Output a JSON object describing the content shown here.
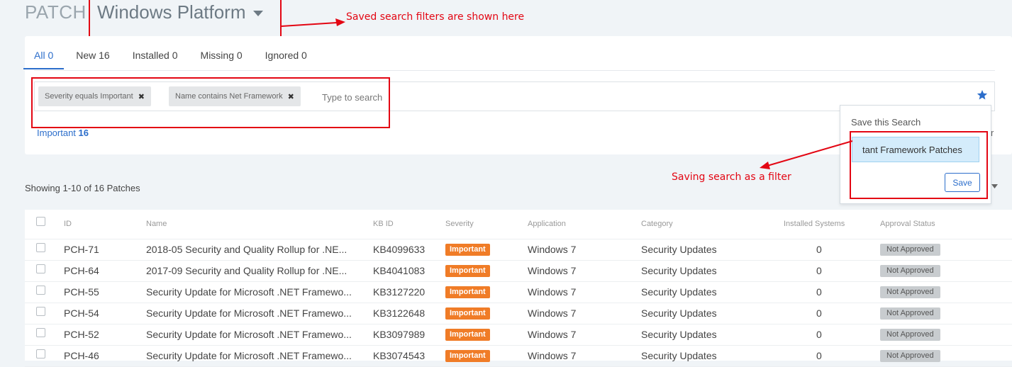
{
  "header": {
    "title": "PATCH",
    "platform": "Windows Platform"
  },
  "annotations": {
    "saved_filters_note": "Saved search filters are shown here",
    "saving_note": "Saving search as a filter"
  },
  "tabs": [
    {
      "label": "All 0"
    },
    {
      "label": "New 16"
    },
    {
      "label": "Installed 0"
    },
    {
      "label": "Missing 0"
    },
    {
      "label": "Ignored 0"
    }
  ],
  "filters": [
    {
      "label": "Severity equals Important"
    },
    {
      "label": "Name contains Net Framework"
    }
  ],
  "search": {
    "placeholder": "Type to search"
  },
  "facet": {
    "label": "Important",
    "count": "16"
  },
  "save_popover": {
    "title": "Save this Search",
    "name_value": "tant Framework Patches",
    "save_label": "Save",
    "edge_text": "r"
  },
  "results": {
    "summary": "Showing 1-10 of 16 Patches"
  },
  "table": {
    "columns": [
      "ID",
      "Name",
      "KB ID",
      "Severity",
      "Application",
      "Category",
      "Installed Systems",
      "Approval Status"
    ],
    "rows": [
      {
        "id": "PCH-71",
        "name": "2018-05 Security and Quality Rollup for .NE...",
        "kb": "KB4099633",
        "severity": "Important",
        "application": "Windows 7",
        "category": "Security Updates",
        "installed": "0",
        "approval": "Not Approved"
      },
      {
        "id": "PCH-64",
        "name": "2017-09 Security and Quality Rollup for .NE...",
        "kb": "KB4041083",
        "severity": "Important",
        "application": "Windows 7",
        "category": "Security Updates",
        "installed": "0",
        "approval": "Not Approved"
      },
      {
        "id": "PCH-55",
        "name": "Security Update for Microsoft .NET Framewo...",
        "kb": "KB3127220",
        "severity": "Important",
        "application": "Windows 7",
        "category": "Security Updates",
        "installed": "0",
        "approval": "Not Approved"
      },
      {
        "id": "PCH-54",
        "name": "Security Update for Microsoft .NET Framewo...",
        "kb": "KB3122648",
        "severity": "Important",
        "application": "Windows 7",
        "category": "Security Updates",
        "installed": "0",
        "approval": "Not Approved"
      },
      {
        "id": "PCH-52",
        "name": "Security Update for Microsoft .NET Framewo...",
        "kb": "KB3097989",
        "severity": "Important",
        "application": "Windows 7",
        "category": "Security Updates",
        "installed": "0",
        "approval": "Not Approved"
      },
      {
        "id": "PCH-46",
        "name": "Security Update for Microsoft .NET Framewo...",
        "kb": "KB3074543",
        "severity": "Important",
        "application": "Windows 7",
        "category": "Security Updates",
        "installed": "0",
        "approval": "Not Approved"
      }
    ]
  },
  "colors": {
    "accent": "#2c6ecb",
    "severity_important": "#f07c27",
    "annotation": "#e30613",
    "approval_badge": "#c8cccf"
  }
}
